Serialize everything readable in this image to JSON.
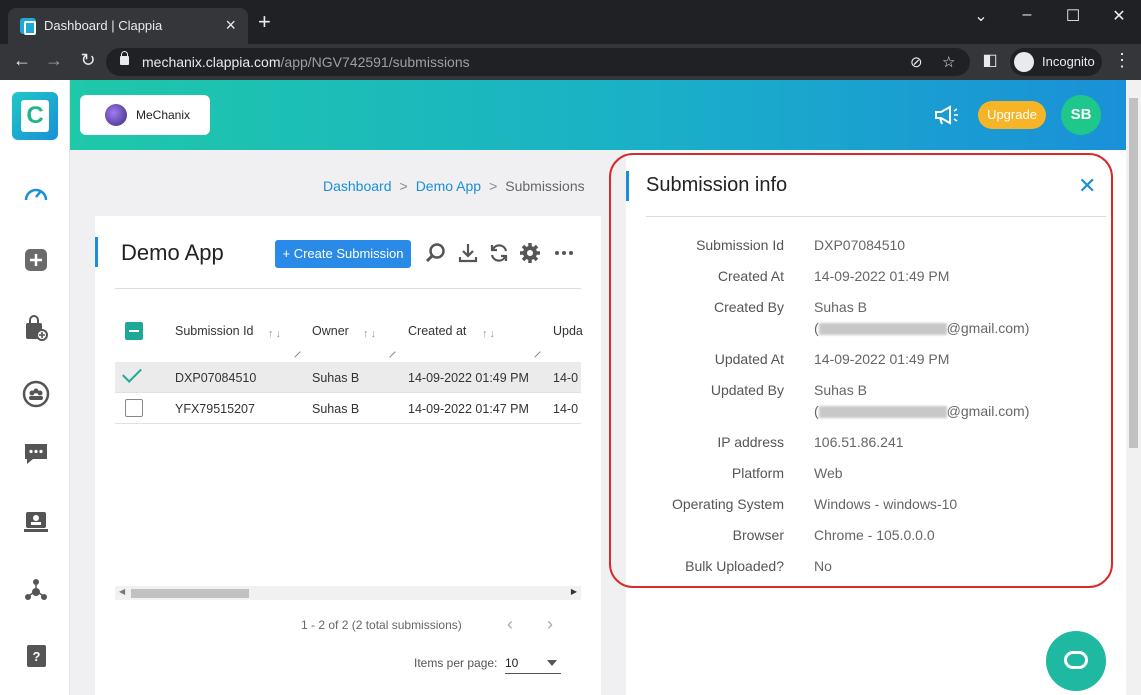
{
  "browser": {
    "tab_title": "Dashboard | Clappia",
    "url_domain": "mechanix.clappia.com",
    "url_path": "/app/NGV742591/submissions",
    "incognito_label": "Incognito"
  },
  "header": {
    "brand_name": "MeChanix",
    "upgrade_label": "Upgrade",
    "avatar_initials": "SB"
  },
  "breadcrumb": [
    "Dashboard",
    "Demo App",
    "Submissions"
  ],
  "app": {
    "title": "Demo App",
    "create_label": "+ Create Submission",
    "columns": [
      "Submission Id",
      "Owner",
      "Created at",
      "Upda"
    ],
    "rows": [
      {
        "id": "DXP07084510",
        "owner": "Suhas B",
        "created": "14-09-2022 01:49 PM",
        "updated": "14-0"
      },
      {
        "id": "YFX79515207",
        "owner": "Suhas B",
        "created": "14-09-2022 01:47 PM",
        "updated": "14-0"
      }
    ],
    "pagination": "1 - 2 of 2 (2 total submissions)",
    "items_per_page_label": "Items per page:",
    "items_per_page_value": "10"
  },
  "panel": {
    "title": "Submission info",
    "fields": [
      {
        "label": "Submission Id",
        "value": "DXP07084510"
      },
      {
        "label": "Created At",
        "value": "14-09-2022 01:49 PM"
      },
      {
        "label": "Created By",
        "value": "Suhas B",
        "email_suffix": "@gmail.com"
      },
      {
        "label": "Updated At",
        "value": "14-09-2022 01:49 PM"
      },
      {
        "label": "Updated By",
        "value": "Suhas B",
        "email_suffix": "@gmail.com"
      },
      {
        "label": "IP address",
        "value": "106.51.86.241"
      },
      {
        "label": "Platform",
        "value": "Web"
      },
      {
        "label": "Operating System",
        "value": "Windows - windows-10"
      },
      {
        "label": "Browser",
        "value": "Chrome - 105.0.0.0"
      },
      {
        "label": "Bulk Uploaded?",
        "value": "No"
      }
    ]
  },
  "colors": {
    "accent": "#1a8fd8",
    "teal": "#1fa898",
    "upgrade": "#f5b526",
    "highlight": "#d92a2a"
  },
  "icons": [
    "search-icon",
    "download-icon",
    "refresh-icon",
    "settings-icon",
    "more-icon",
    "megaphone-icon",
    "close-icon",
    "chat-icon"
  ]
}
